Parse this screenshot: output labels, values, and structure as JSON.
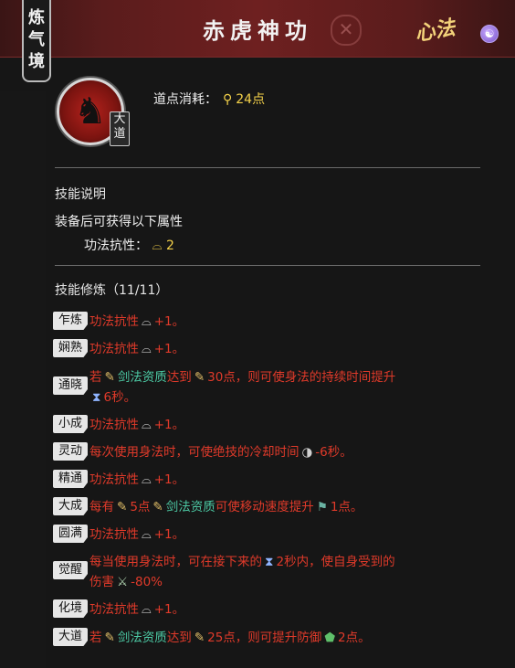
{
  "realm_tag": [
    "炼",
    "气",
    "境"
  ],
  "title": "赤虎神功",
  "close_icon": "close-icon",
  "xinfa_label": "心法",
  "grade_badge": [
    "大",
    "道"
  ],
  "cost": {
    "label": "道点消耗：",
    "value": "24点"
  },
  "desc": {
    "section_title": "技能说明",
    "main": "装备后可获得以下属性",
    "attr_label": "功法抗性：",
    "attr_value": "2"
  },
  "training": {
    "section_title": "技能修炼（11/11）",
    "rows": [
      {
        "tag": "乍炼",
        "text": "功法抗性",
        "suffix": "+1。"
      },
      {
        "tag": "娴熟",
        "text": "功法抗性",
        "suffix": "+1。"
      },
      {
        "tag": "通晓",
        "p1": "若",
        "p2": "剑法资质",
        "p3": "达到",
        "p4": "30点，则可使身法的持续时间提升",
        "p5": "6秒。"
      },
      {
        "tag": "小成",
        "text": "功法抗性",
        "suffix": "+1。"
      },
      {
        "tag": "灵动",
        "p1": "每次使用身法时，可使绝技的冷却时间",
        "p2": "-6秒。"
      },
      {
        "tag": "精通",
        "text": "功法抗性",
        "suffix": "+1。"
      },
      {
        "tag": "大成",
        "p1": "每有",
        "p2": "5点",
        "p3": "剑法资质",
        "p4": "可使移动速度提升",
        "p5": "1点。"
      },
      {
        "tag": "圆满",
        "text": "功法抗性",
        "suffix": "+1。"
      },
      {
        "tag": "觉醒",
        "p1": "每当使用身法时，可在接下来的",
        "p2": "2秒内，使自身受到的",
        "p3": "伤害",
        "p4": "-80%"
      },
      {
        "tag": "化境",
        "text": "功法抗性",
        "suffix": "+1。"
      },
      {
        "tag": "大道",
        "p1": "若",
        "p2": "剑法资质",
        "p3": "达到",
        "p4": "25点，则可提升防御",
        "p5": "2点。"
      }
    ]
  },
  "colors": {
    "accent_red": "#e03a2a",
    "yellow": "#f5d24a",
    "teal": "#4cc9a4",
    "title_bg": "#6e2020"
  }
}
